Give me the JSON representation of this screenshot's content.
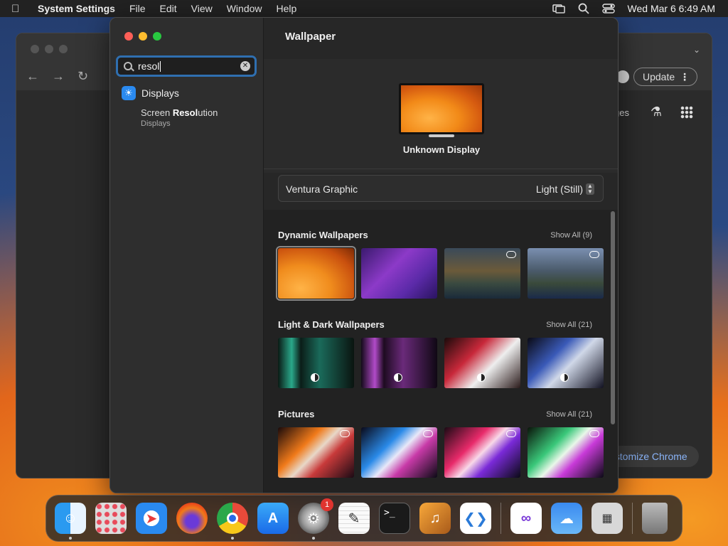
{
  "menubar": {
    "app_name": "System Settings",
    "items": [
      "File",
      "Edit",
      "View",
      "Window",
      "Help"
    ],
    "clock": "Wed Mar 6  6:49 AM"
  },
  "chrome": {
    "update_label": "Update",
    "partial_text": "ges",
    "customize_label": "ustomize Chrome"
  },
  "settings": {
    "search": {
      "value": "resol"
    },
    "results": {
      "category": "Displays",
      "item_prefix": "Screen ",
      "item_match": "Resol",
      "item_suffix": "ution",
      "item_sub": "Displays"
    },
    "main": {
      "title": "Wallpaper",
      "display_name": "Unknown Display",
      "wallpaper_name": "Ventura Graphic",
      "wallpaper_mode": "Light (Still)",
      "sections": [
        {
          "title": "Dynamic Wallpapers",
          "show_all": "Show All (9)"
        },
        {
          "title": "Light & Dark Wallpapers",
          "show_all": "Show All (21)"
        },
        {
          "title": "Pictures",
          "show_all": "Show All (21)"
        }
      ]
    }
  },
  "dock": {
    "apps": [
      "finder",
      "launchpad",
      "safari",
      "firefox",
      "chrome",
      "app-store",
      "system-settings",
      "textedit",
      "terminal",
      "garageband",
      "vscode",
      "visual-studio",
      "weather",
      "calculator",
      "trash"
    ],
    "settings_badge": "1"
  }
}
